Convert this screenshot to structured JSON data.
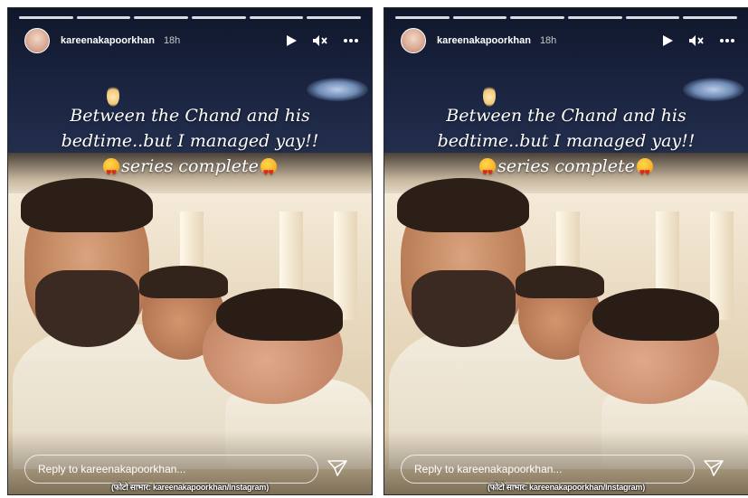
{
  "story": {
    "username": "kareenakapoorkhan",
    "time": "18h",
    "progress_segments": 6,
    "caption_lines": [
      "Between the Chand and his",
      "bedtime..but I managed yay!!",
      "series complete"
    ],
    "reply_placeholder": "Reply to kareenakapoorkhan...",
    "credit": "(फोटो साभार: kareenakapoorkhan/Instagram)",
    "icons": {
      "play": "play-icon",
      "mute": "mute-icon",
      "more": "more-options-icon",
      "send": "send-icon",
      "emoji": "heart-eyes-emoji"
    }
  }
}
